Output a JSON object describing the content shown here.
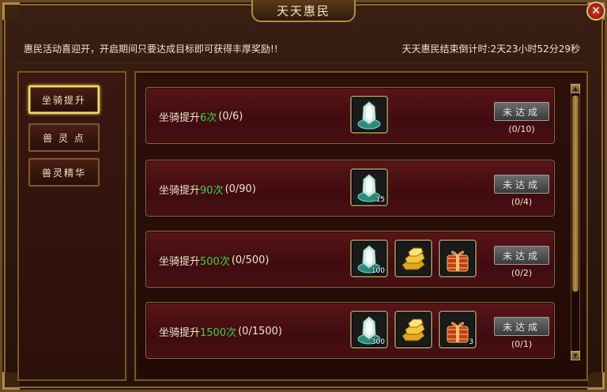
{
  "window": {
    "title": "天天惠民"
  },
  "close_icon_label": "✕",
  "info": {
    "notice": "惠民活动喜迎开，开启期间只要达成目标即可获得丰厚奖励!!",
    "countdown": "天天惠民结束倒计时:2天23小时52分29秒"
  },
  "nav": {
    "items": [
      {
        "label": "坐骑提升",
        "active": true
      },
      {
        "label": "兽 灵 点",
        "active": false
      },
      {
        "label": "兽灵精华",
        "active": false
      }
    ]
  },
  "tasks": [
    {
      "prefix": "坐骑提升",
      "count": "6次",
      "progress": "(0/6)",
      "rewards": [
        {
          "icon": "mount-gem-icon",
          "qty": ""
        }
      ],
      "button": "未达成",
      "claims": "(0/10)"
    },
    {
      "prefix": "坐骑提升",
      "count": "90次",
      "progress": "(0/90)",
      "rewards": [
        {
          "icon": "mount-gem-icon",
          "qty": "15"
        }
      ],
      "button": "未达成",
      "claims": "(0/4)"
    },
    {
      "prefix": "坐骑提升",
      "count": "500次",
      "progress": "(0/500)",
      "rewards": [
        {
          "icon": "mount-gem-icon",
          "qty": "100"
        },
        {
          "icon": "gold-bars-icon",
          "qty": ""
        },
        {
          "icon": "gift-box-icon",
          "qty": ""
        }
      ],
      "button": "未达成",
      "claims": "(0/2)"
    },
    {
      "prefix": "坐骑提升",
      "count": "1500次",
      "progress": "(0/1500)",
      "rewards": [
        {
          "icon": "mount-gem-icon",
          "qty": "300"
        },
        {
          "icon": "gold-bars-icon",
          "qty": ""
        },
        {
          "icon": "gift-box-icon",
          "qty": "3"
        }
      ],
      "button": "未达成",
      "claims": "(0/1)"
    }
  ],
  "colors": {
    "highlight": "#3fd04a",
    "active_border": "#f2dc6a"
  }
}
